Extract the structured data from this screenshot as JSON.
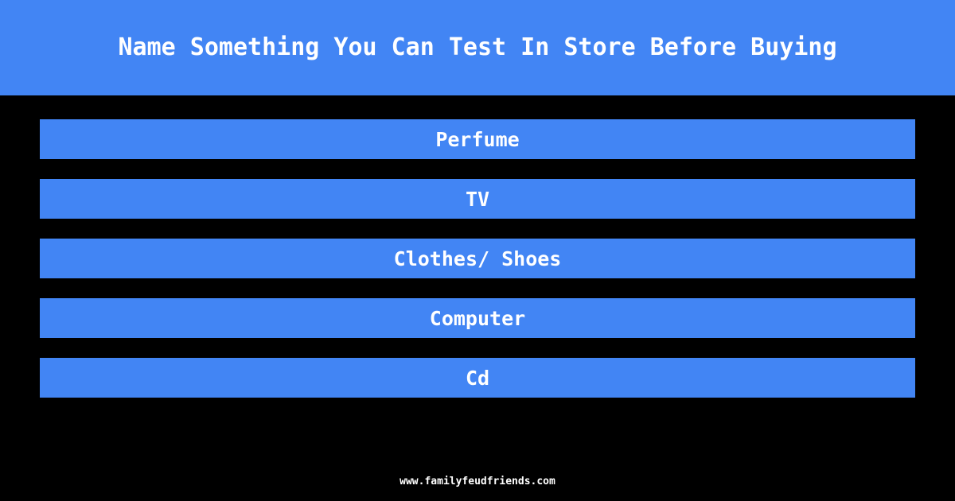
{
  "header": {
    "title": "Name Something You Can Test In Store Before Buying",
    "background_color": "#4285f4",
    "text_color": "#ffffff"
  },
  "answers": {
    "bar_color": "#4285f4",
    "text_color": "#ffffff",
    "items": [
      {
        "label": "Perfume"
      },
      {
        "label": "TV"
      },
      {
        "label": "Clothes/ Shoes"
      },
      {
        "label": "Computer"
      },
      {
        "label": "Cd"
      }
    ]
  },
  "footer": {
    "site": "www.familyfeudfriends.com"
  },
  "page": {
    "background_color": "#000000"
  }
}
